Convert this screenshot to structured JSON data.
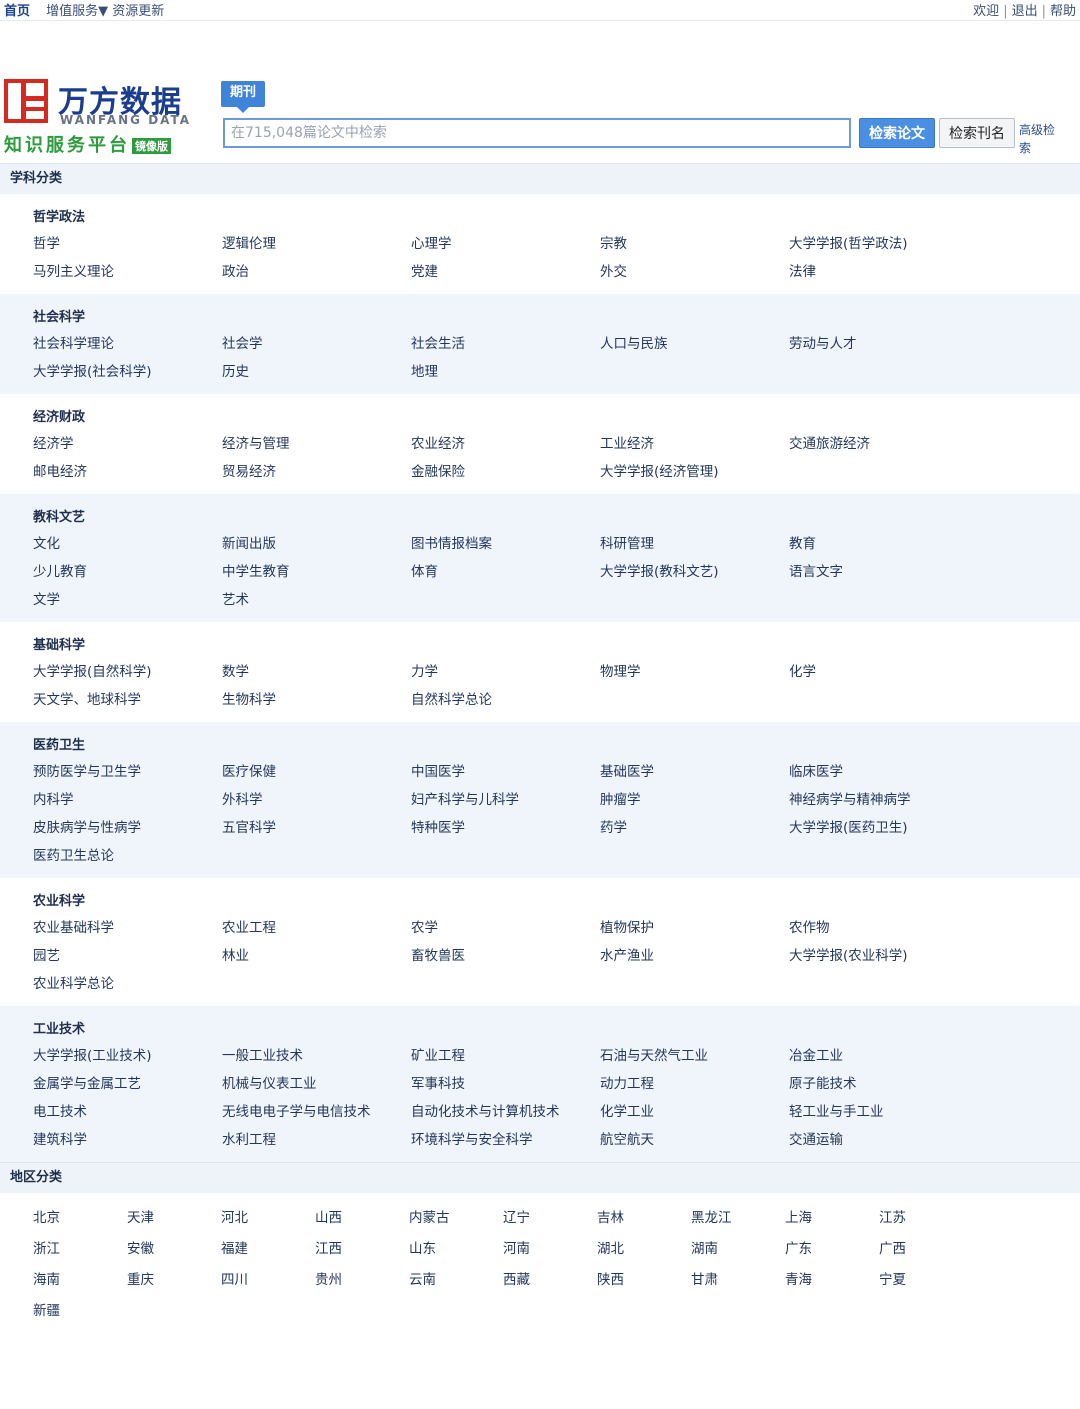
{
  "topbar": {
    "home": "首页",
    "links": [
      "增值服务▼",
      "资源更新"
    ],
    "right": [
      "欢迎",
      "退出",
      "帮助"
    ]
  },
  "logo": {
    "cn": "万方数据",
    "en": "WANFANG DATA",
    "slogan": "知识服务平台",
    "tag": "镜像版",
    "colors": {
      "red": "#d62a20",
      "blue": "#1a3d8f",
      "green": "#2e9b3c"
    }
  },
  "search": {
    "tab": "期刊",
    "placeholder": "在715,048篇论文中检索",
    "btn_search": "检索论文",
    "btn_journal": "检索刊名",
    "advanced": "高级检索"
  },
  "subject_title": "学科分类",
  "groups": [
    {
      "title": "哲学政法",
      "items": [
        "哲学",
        "逻辑伦理",
        "心理学",
        "宗教",
        "大学学报(哲学政法)",
        "马列主义理论",
        "政治",
        "党建",
        "外交",
        "法律"
      ]
    },
    {
      "title": "社会科学",
      "items": [
        "社会科学理论",
        "社会学",
        "社会生活",
        "人口与民族",
        "劳动与人才",
        "大学学报(社会科学)",
        "历史",
        "地理"
      ]
    },
    {
      "title": "经济财政",
      "items": [
        "经济学",
        "经济与管理",
        "农业经济",
        "工业经济",
        "交通旅游经济",
        "邮电经济",
        "贸易经济",
        "金融保险",
        "大学学报(经济管理)"
      ]
    },
    {
      "title": "教科文艺",
      "items": [
        "文化",
        "新闻出版",
        "图书情报档案",
        "科研管理",
        "教育",
        "少儿教育",
        "中学生教育",
        "体育",
        "大学学报(教科文艺)",
        "语言文字",
        "文学",
        "艺术"
      ]
    },
    {
      "title": "基础科学",
      "items": [
        "大学学报(自然科学)",
        "数学",
        "力学",
        "物理学",
        "化学",
        "天文学、地球科学",
        "生物科学",
        "自然科学总论"
      ]
    },
    {
      "title": "医药卫生",
      "items": [
        "预防医学与卫生学",
        "医疗保健",
        "中国医学",
        "基础医学",
        "临床医学",
        "内科学",
        "外科学",
        "妇产科学与儿科学",
        "肿瘤学",
        "神经病学与精神病学",
        "皮肤病学与性病学",
        "五官科学",
        "特种医学",
        "药学",
        "大学学报(医药卫生)",
        "医药卫生总论"
      ]
    },
    {
      "title": "农业科学",
      "items": [
        "农业基础科学",
        "农业工程",
        "农学",
        "植物保护",
        "农作物",
        "园艺",
        "林业",
        "畜牧兽医",
        "水产渔业",
        "大学学报(农业科学)",
        "农业科学总论"
      ]
    },
    {
      "title": "工业技术",
      "items": [
        "大学学报(工业技术)",
        "一般工业技术",
        "矿业工程",
        "石油与天然气工业",
        "冶金工业",
        "金属学与金属工艺",
        "机械与仪表工业",
        "军事科技",
        "动力工程",
        "原子能技术",
        "电工技术",
        "无线电电子学与电信技术",
        "自动化技术与计算机技术",
        "化学工业",
        "轻工业与手工业",
        "建筑科学",
        "水利工程",
        "环境科学与安全科学",
        "航空航天",
        "交通运输"
      ]
    }
  ],
  "region_title": "地区分类",
  "regions": [
    "北京",
    "天津",
    "河北",
    "山西",
    "内蒙古",
    "辽宁",
    "吉林",
    "黑龙江",
    "上海",
    "江苏",
    "浙江",
    "安徽",
    "福建",
    "江西",
    "山东",
    "河南",
    "湖北",
    "湖南",
    "广东",
    "广西",
    "海南",
    "重庆",
    "四川",
    "贵州",
    "云南",
    "西藏",
    "陕西",
    "甘肃",
    "青海",
    "宁夏",
    "新疆"
  ]
}
